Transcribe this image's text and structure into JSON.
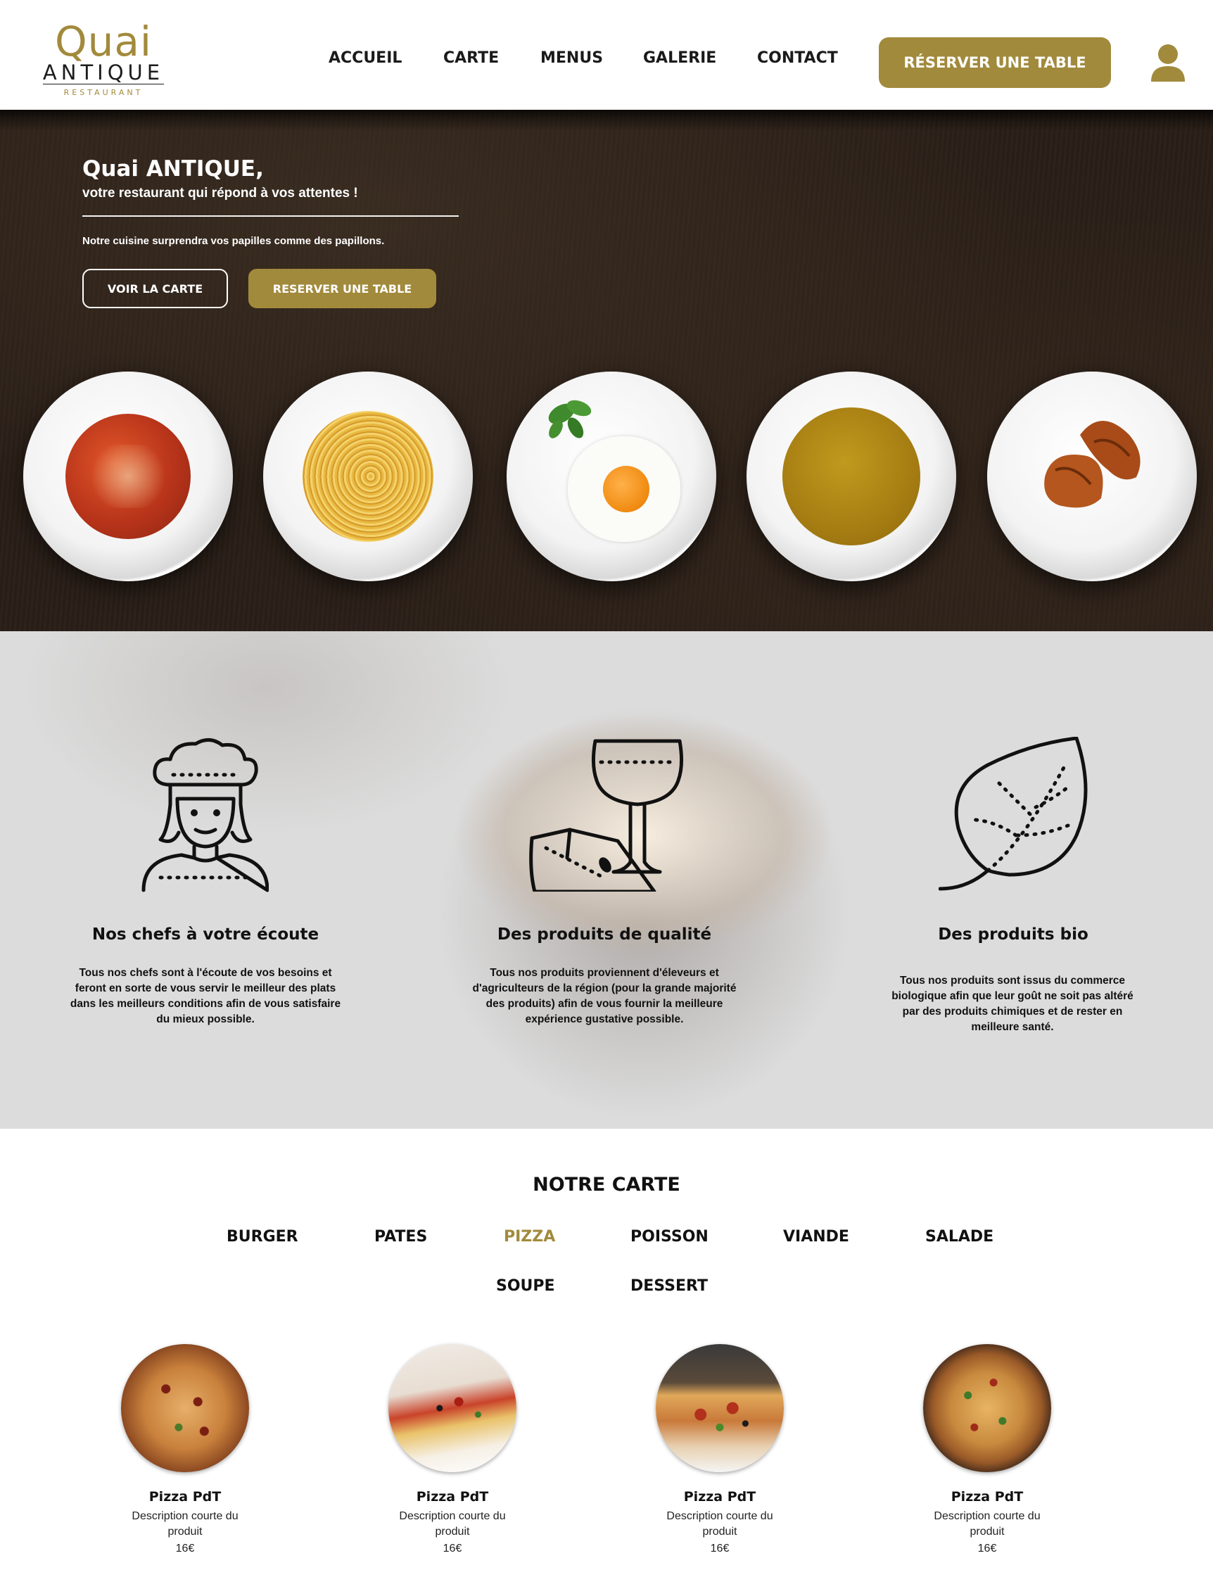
{
  "brand": {
    "logo_main": "Quai",
    "logo_secondary": "ANTIQUE",
    "logo_sub": "RESTAURANT",
    "accent_color": "#a28a3c"
  },
  "nav": {
    "items": [
      "ACCUEIL",
      "CARTE",
      "MENUS",
      "GALERIE",
      "CONTACT"
    ],
    "reserve_label": "RÉSERVER UNE TABLE",
    "user_icon": "user-icon"
  },
  "hero": {
    "title": "Quai ANTIQUE,",
    "subtitle": "votre restaurant qui répond à vos attentes !",
    "tagline": "Notre cuisine surprendra vos papilles comme des papillons.",
    "btn_menu": "VOIR LA CARTE",
    "btn_reserve": "RESERVER UNE TABLE"
  },
  "features": [
    {
      "icon": "chef-icon",
      "title": "Nos chefs à votre écoute",
      "text": "Tous nos chefs sont à l'écoute de vos besoins et feront en sorte de vous servir le meilleur des plats dans les meilleurs conditions afin de vous satisfaire du mieux possible."
    },
    {
      "icon": "wine-cheese-icon",
      "title": "Des produits de qualité",
      "text": "Tous nos produits proviennent d'éleveurs et d'agriculteurs de la région (pour la grande majorité des produits) afin de vous fournir la meilleure expérience gustative possible."
    },
    {
      "icon": "leaf-icon",
      "title": "Des produits bio",
      "text": "Tous nos produits sont issus du commerce biologique afin que leur goût ne soit pas altéré par des produits chimiques et de rester en meilleure santé."
    }
  ],
  "carte": {
    "title": "NOTRE CARTE",
    "categories": [
      "BURGER",
      "PATES",
      "PIZZA",
      "POISSON",
      "VIANDE",
      "SALADE",
      "SOUPE",
      "DESSERT"
    ],
    "active_category": "PIZZA",
    "products": [
      {
        "name": "Pizza PdT",
        "desc": "Description courte du produit",
        "price": "16€"
      },
      {
        "name": "Pizza PdT",
        "desc": "Description courte du produit",
        "price": "16€"
      },
      {
        "name": "Pizza PdT",
        "desc": "Description courte du produit",
        "price": "16€"
      },
      {
        "name": "Pizza PdT",
        "desc": "Description courte du produit",
        "price": "16€"
      }
    ]
  }
}
